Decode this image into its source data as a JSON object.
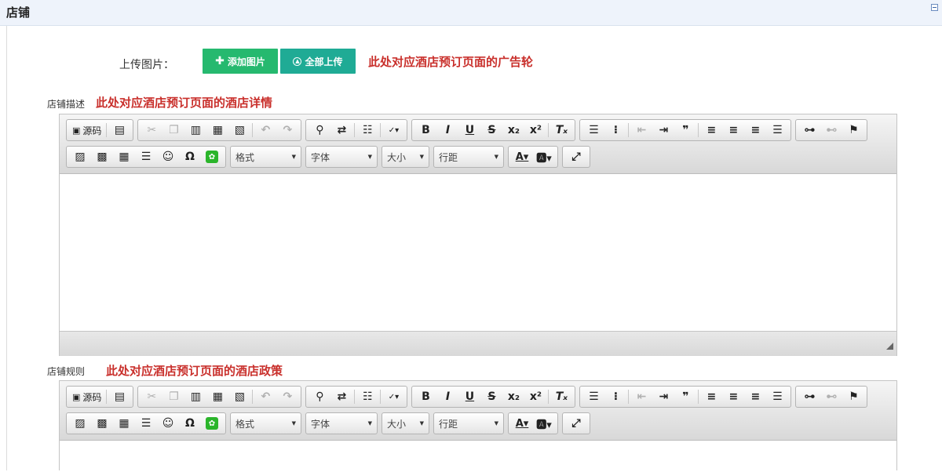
{
  "header": {
    "title": "店铺"
  },
  "upload": {
    "label": "上传图片：",
    "add_button": "添加图片",
    "upload_all_button": "全部上传",
    "note": "此处对应酒店预订页面的广告轮"
  },
  "description": {
    "label": "店铺描述",
    "note": "此处对应酒店预订页面的酒店详情"
  },
  "rules": {
    "label": "店铺规则",
    "note": "此处对应酒店预订页面的酒店政策"
  },
  "toolbar": {
    "source": "源码",
    "format": "格式",
    "font": "字体",
    "size": "大小",
    "line_height": "行距"
  },
  "colors": {
    "add": "#26b96f",
    "upload": "#1fab95",
    "note": "#c9302c"
  }
}
